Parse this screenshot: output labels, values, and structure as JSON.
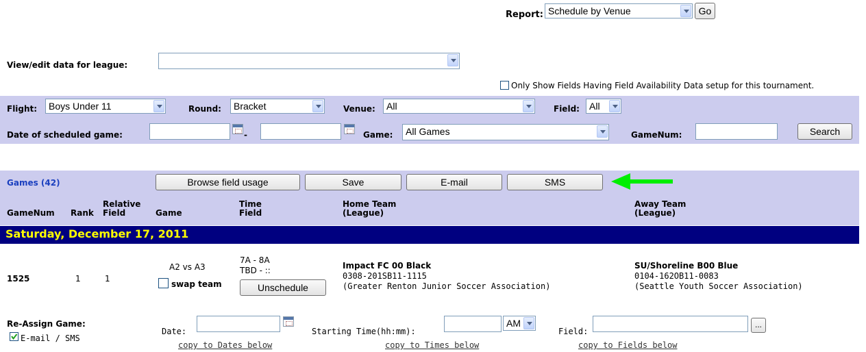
{
  "report": {
    "label": "Report:",
    "selected": "Schedule by Venue",
    "go_label": "Go"
  },
  "league": {
    "label": "View/edit data for league:",
    "selected": ""
  },
  "only_show_fields": {
    "label": "Only Show Fields Having Field Availability Data setup for this tournament.",
    "checked": false
  },
  "filters": {
    "flight_label": "Flight:",
    "flight_value": "Boys Under 11",
    "round_label": "Round:",
    "round_value": "Bracket",
    "venue_label": "Venue:",
    "venue_value": "All",
    "field_label": "Field:",
    "field_value": "All",
    "date_label": "Date of scheduled game:",
    "date_from": "",
    "date_sep": "-",
    "date_to": "",
    "game_label": "Game:",
    "game_value": "All Games",
    "gamenum_label": "GameNum:",
    "gamenum_value": "",
    "search_label": "Search"
  },
  "games_bar": {
    "count_label": "Games (42)",
    "browse_label": "Browse field usage",
    "save_label": "Save",
    "email_label": "E-mail",
    "sms_label": "SMS",
    "arrow_color": "#00ee00"
  },
  "columns": {
    "gamenum": "GameNum",
    "rank": "Rank",
    "relative_1": "Relative",
    "relative_2": "Field",
    "game": "Game",
    "time_1": "Time",
    "time_2": "Field",
    "home_1": "Home Team",
    "home_2": "(League)",
    "away_1": "Away Team",
    "away_2": "(League)"
  },
  "day_header": {
    "text": "Saturday, December 17, 2011",
    "bg": "#000080",
    "fg": "#ffff00"
  },
  "game_row": {
    "gamenum": "1525",
    "rank": "1",
    "relative_field": "1",
    "matchup": "A2 vs A3",
    "swap_label": "swap team",
    "swap_checked": false,
    "time": "7A - 8A",
    "field": "TBD - ::",
    "unschedule_label": "Unschedule",
    "home_name": "Impact FC 00 Black",
    "home_code": "0308-201SB11-1115",
    "home_league": "(Greater Renton Junior Soccer Association)",
    "away_name": "SU/Shoreline B00 Blue",
    "away_code": "0104-162OB11-0083",
    "away_league": "(Seattle Youth Soccer Association)"
  },
  "reassign": {
    "title": "Re-Assign Game:",
    "email_sms_label": "E-mail / SMS",
    "email_sms_checked": true,
    "date_label": "Date:",
    "date_value": "",
    "time_label": "Starting Time(hh:mm):",
    "time_value": "",
    "ampm_value": "AM",
    "field_label": "Field:",
    "field_value": "",
    "field_browse_label": "...",
    "copy_dates": "copy to Dates below",
    "copy_times": "copy to Times below",
    "copy_fields": "copy to Fields below"
  }
}
